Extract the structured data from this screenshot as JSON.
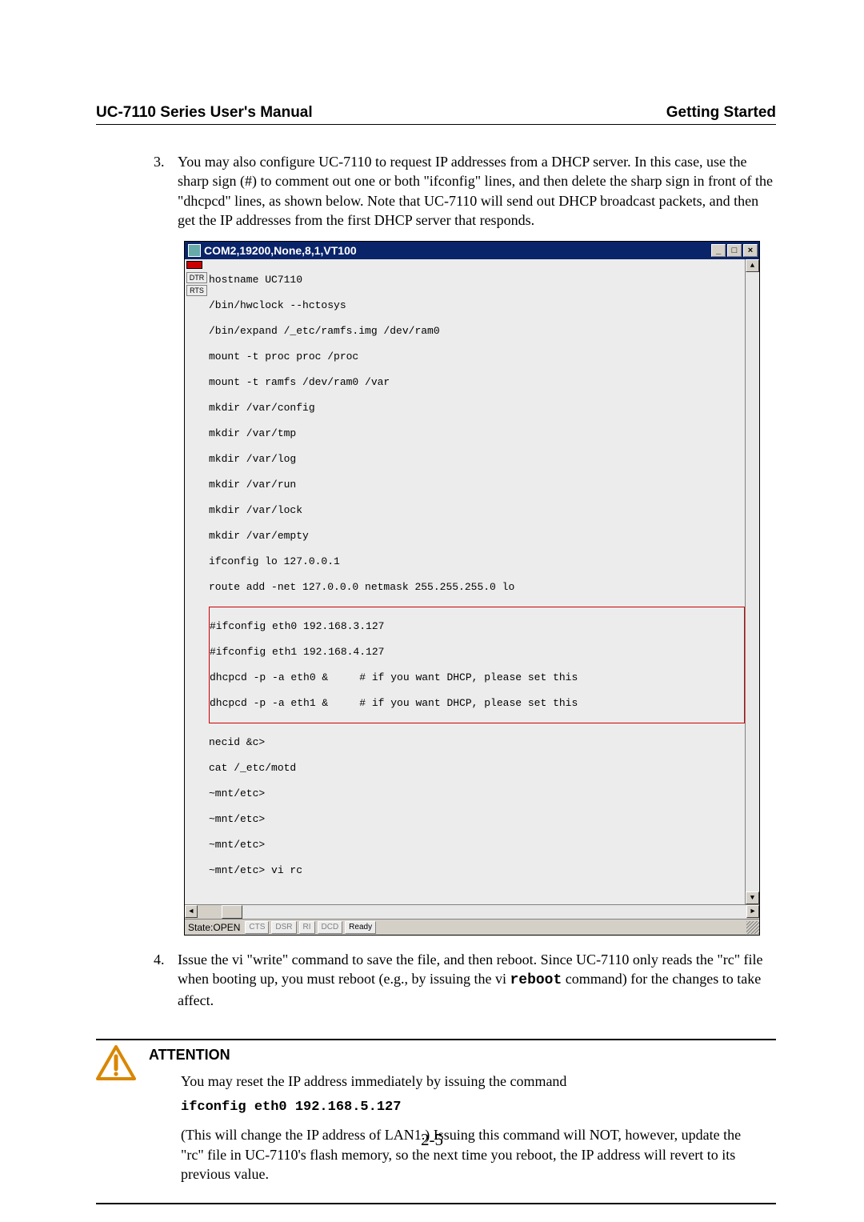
{
  "header": {
    "left": "UC-7110 Series User's Manual",
    "right": "Getting Started"
  },
  "list": {
    "item3": "You may also configure UC-7110 to request IP addresses from a DHCP server. In this case, use the sharp sign (#) to comment out one or both \"ifconfig\" lines, and then delete the sharp sign in front of the \"dhcpcd\" lines, as shown below. Note that UC-7110 will send out DHCP broadcast packets, and then get the IP addresses from the first DHCP server that responds.",
    "item4_a": "Issue the vi \"write\" command to save the file, and then reboot. Since UC-7110 only reads the \"rc\" file when booting up, you must reboot (e.g., by issuing the vi ",
    "item4_code": "reboot",
    "item4_b": " command) for the changes to take affect."
  },
  "terminal": {
    "title": "COM2,19200,None,8,1,VT100",
    "win": {
      "min": "_",
      "max": "□",
      "close": "×"
    },
    "side": {
      "dtr": "DTR",
      "rts": "RTS"
    },
    "lines_pre": [
      "hostname UC7110",
      "/bin/hwclock --hctosys",
      "/bin/expand /_etc/ramfs.img /dev/ram0",
      "mount -t proc proc /proc",
      "mount -t ramfs /dev/ram0 /var",
      "mkdir /var/config",
      "mkdir /var/tmp",
      "mkdir /var/log",
      "mkdir /var/run",
      "mkdir /var/lock",
      "mkdir /var/empty",
      "ifconfig lo 127.0.0.1",
      "route add -net 127.0.0.0 netmask 255.255.255.0 lo"
    ],
    "lines_boxed": [
      "#ifconfig eth0 192.168.3.127",
      "#ifconfig eth1 192.168.4.127",
      "dhcpcd -p -a eth0 &     # if you want DHCP, please set this",
      "dhcpcd -p -a eth1 &     # if you want DHCP, please set this"
    ],
    "lines_post": [
      "necid &c>",
      "cat /_etc/motd",
      "~mnt/etc>",
      "~mnt/etc>",
      "~mnt/etc>",
      "~mnt/etc> vi rc"
    ],
    "scroll": {
      "up": "▲",
      "down": "▼",
      "left": "◄",
      "right": "►"
    },
    "status": {
      "state": "State:OPEN",
      "cts": "CTS",
      "dsr": "DSR",
      "ri": "RI",
      "dcd": "DCD",
      "ready": "Ready"
    }
  },
  "attention": {
    "title": "ATTENTION",
    "p1": "You may reset the IP address immediately by issuing the command",
    "cmd": "ifconfig eth0 192.168.5.127",
    "p2": "(This will change the IP address of LAN1.) Issuing this command will NOT, however, update the \"rc\" file in UC-7110's flash memory, so the next time you reboot, the IP address will revert to its previous value."
  },
  "page_number": "2-5"
}
